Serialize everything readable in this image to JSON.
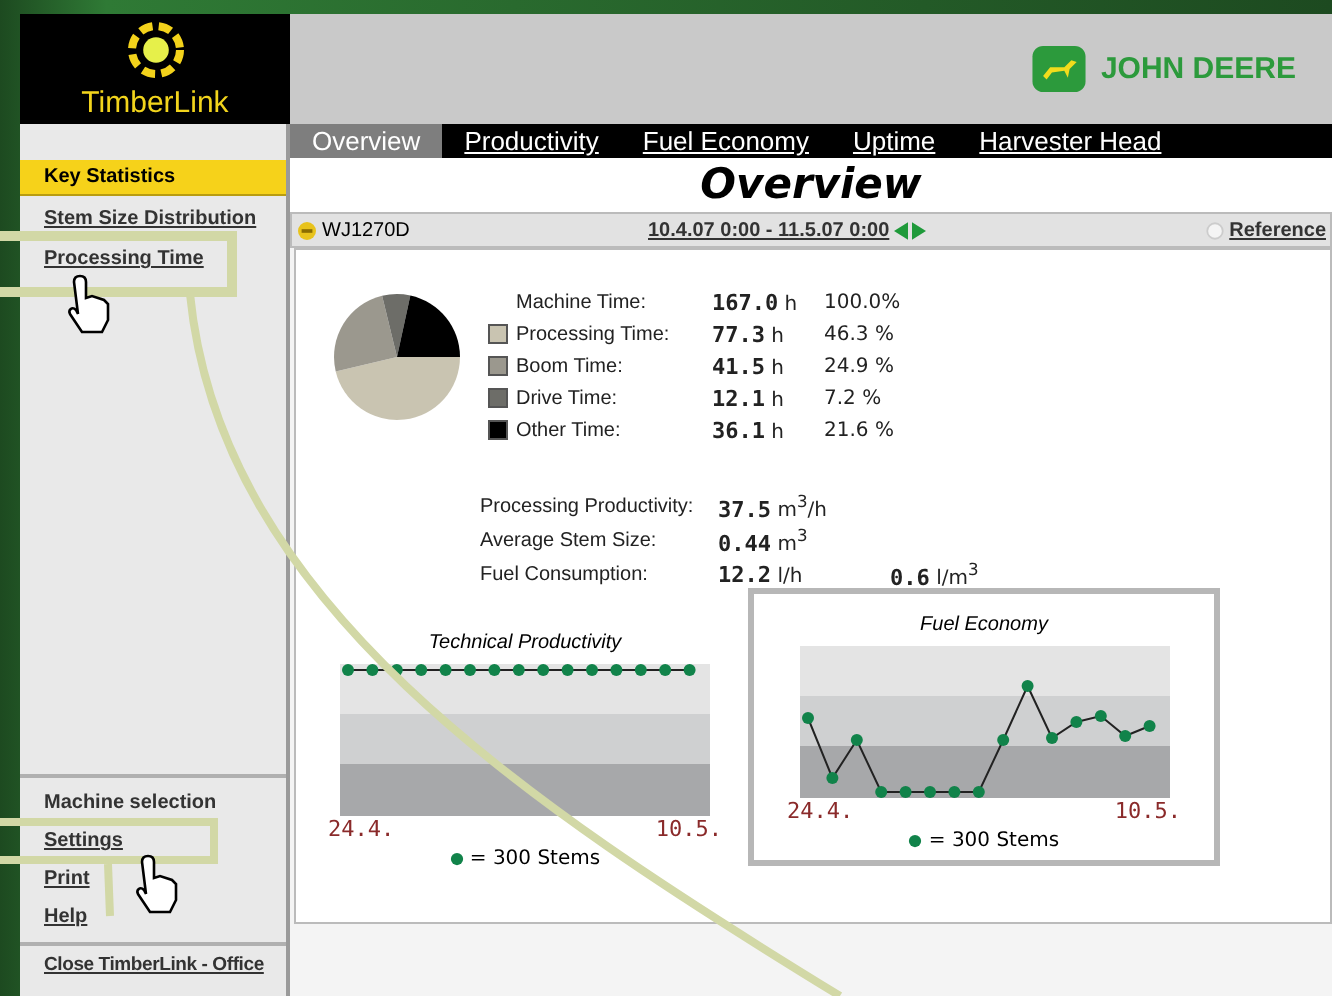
{
  "app": {
    "name": "TimberLink"
  },
  "brand": {
    "name": "JOHN DEERE"
  },
  "sidebar": {
    "items": [
      {
        "label": "Key Statistics",
        "selected": true
      },
      {
        "label": "Stem Size Distribution",
        "selected": false
      },
      {
        "label": "Processing Time",
        "selected": false
      }
    ],
    "bottom_items": [
      {
        "label": "Machine selection",
        "kind": "heading"
      },
      {
        "label": "Settings",
        "kind": "link"
      },
      {
        "label": "Print",
        "kind": "link"
      },
      {
        "label": "Help",
        "kind": "link"
      },
      {
        "label": "Close TimberLink - Office",
        "kind": "exit"
      }
    ]
  },
  "tabs": [
    {
      "label": "Overview",
      "selected": true
    },
    {
      "label": "Productivity",
      "selected": false
    },
    {
      "label": "Fuel Economy",
      "selected": false
    },
    {
      "label": "Uptime",
      "selected": false
    },
    {
      "label": "Harvester Head",
      "selected": false
    }
  ],
  "page_title": "Overview",
  "toolbar": {
    "machine": "WJ1270D",
    "period": "10.4.07 0:00 - 11.5.07 0:00",
    "reference": "Reference"
  },
  "time_table": {
    "rows": [
      {
        "label": "Machine Time:",
        "value": "167.0",
        "unit": "h",
        "share": "100.0%"
      },
      {
        "label": "Processing Time:",
        "value": "77.3",
        "unit": "h",
        "share": "46.3 %",
        "color": "#c9c4b1"
      },
      {
        "label": "Boom Time:",
        "value": "41.5",
        "unit": "h",
        "share": "24.9 %",
        "color": "#9b988e"
      },
      {
        "label": "Drive Time:",
        "value": "12.1",
        "unit": "h",
        "share": "7.2 %",
        "color": "#6d6d68"
      },
      {
        "label": "Other Time:",
        "value": "36.1",
        "unit": "h",
        "share": "21.6 %",
        "color": "#000000"
      }
    ],
    "chart_data": {
      "type": "pie",
      "values": [
        46.3,
        24.9,
        7.2,
        21.6
      ]
    }
  },
  "metrics": [
    {
      "label": "Processing Productivity:",
      "value": "37.5",
      "unit": "m$^{3}$/h"
    },
    {
      "label": "Average Stem Size:",
      "value": "0.44",
      "unit": "m$^{3}$"
    },
    {
      "label": "Fuel Consumption:",
      "value": "12.2",
      "unit": "l/h",
      "extra_value": "0.6",
      "extra_unit": "l/m$^{3}$"
    }
  ],
  "charts": [
    {
      "title": "Technical Productivity",
      "start": "24.4.",
      "end": "10.5.",
      "legend": "= 300 Stems",
      "highlighted": false
    },
    {
      "title": "Fuel Economy",
      "start": "24.4.",
      "end": "10.5.",
      "legend": "= 300 Stems",
      "highlighted": true
    }
  ]
}
